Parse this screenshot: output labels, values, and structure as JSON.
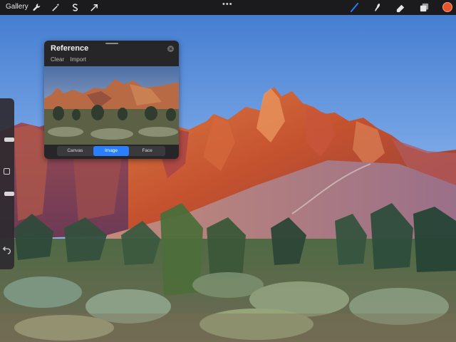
{
  "toolbar": {
    "gallery_label": "Gallery",
    "more_label": "•••",
    "left_icons": [
      "wrench-icon",
      "magic-wand-icon",
      "selection-s-icon",
      "transform-arrow-icon"
    ],
    "right_icons": [
      "brush-icon",
      "smudge-icon",
      "eraser-icon",
      "layers-icon"
    ],
    "active_tool": "brush",
    "current_color": "#e8542b"
  },
  "sidebar": {
    "brush_size_level": 0.35,
    "brush_opacity_level": 0.78,
    "modify_icon": "square-modify-icon",
    "undo_icon": "undo-arrow-icon"
  },
  "reference": {
    "title": "Reference",
    "clear_label": "Clear",
    "import_label": "Import",
    "tabs": [
      "Canvas",
      "Image",
      "Face"
    ],
    "active_tab": "Image"
  },
  "colors": {
    "toolbar_bg": "#1b1b1d",
    "panel_bg": "#262628",
    "accent": "#2a7fff"
  }
}
